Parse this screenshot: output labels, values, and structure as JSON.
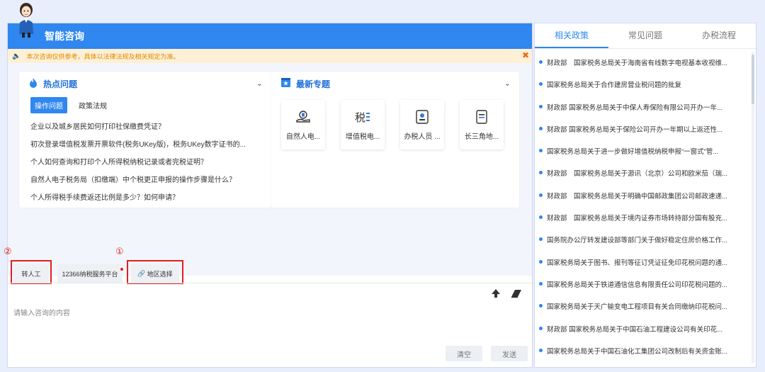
{
  "header": {
    "title": "智能咨询"
  },
  "notice": {
    "text": "本次咨询仅供参考，具体以法律法规及相关规定为准。"
  },
  "hot": {
    "title": "热点问题",
    "tabs": [
      "操作问题",
      "政策法规"
    ],
    "questions": [
      "企业以及城乡居民如何打印社保缴费凭证？",
      "初次登录增值税发票开票软件(税务UKey版)，税务UKey数字证书的...",
      "个人如何查询和打印个人所得税纳税记录或者完税证明？",
      "自然人电子税务局（扣缴端）中个税更正申报的操作步骤是什么？",
      "个人所得税手续费返还比例是多少？如何申请？"
    ]
  },
  "topics": {
    "title": "最新专题",
    "items": [
      {
        "label": "自然人电..."
      },
      {
        "label": "增值税电..."
      },
      {
        "label": "办税人员 ..."
      },
      {
        "label": "长三角地..."
      }
    ]
  },
  "annotations": {
    "one": "①",
    "two": "②"
  },
  "buttons": {
    "transfer": "转人工",
    "platform": "12366纳税服务平台",
    "region": "地区选择",
    "clear": "清空",
    "send": "发送"
  },
  "input": {
    "placeholder": "请输入咨询的内容"
  },
  "right": {
    "tabs": [
      "相关政策",
      "常见问题",
      "办税流程"
    ],
    "policies": [
      "财政部　国家税务总局关于海南省有线数字电视基本收视维...",
      "国家税务总局关于合作建房营业税问题的批复",
      "财政部 国家税务总局关于中保人寿保险有限公司开办一年...",
      "财政部 国家税务总局关于保险公司开办一年期以上返还性...",
      "国家税务总局关于进一步做好增值税纳税申报“一窗式”管...",
      "财政部　国家税务总局关于源讯（北京）公司和欧米茄（瑞...",
      "财政部　国家税务总局关于明确中国邮政集团公司邮政速递...",
      "财政部　国家税务总局关于境内证券市场转持部分国有股充...",
      "国务院办公厅转发建设部等部门关于做好稳定住房价格工作...",
      "国家税务局关于图书、报刊等征订凭证征免印花税问题的通...",
      "国家税务总局关于铁道通信信息有限责任公司印花税问题的...",
      "国家税务局关于天广输变电工程项目有关合同缴纳印花税问...",
      "财政部 国家税务总局关于中国石油工程建设公司有关印花...",
      "国家税务总局关于中国石油化工集团公司改制后有关资金账..."
    ]
  }
}
